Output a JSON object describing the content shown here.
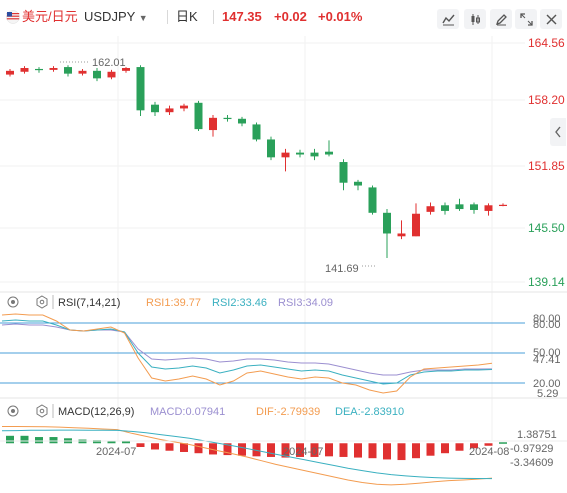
{
  "header": {
    "pair_name": "美元/日元",
    "symbol": "USDJPY",
    "interval": "日K",
    "price": "147.35",
    "change": "+0.02",
    "change_pct": "+0.01%"
  },
  "colors": {
    "up": "#e03030",
    "down": "#2aa05a",
    "rsi1": "#f39c50",
    "rsi2": "#3ab0c0",
    "rsi3": "#9b8fd0",
    "axis_label": "#e03030"
  },
  "main": {
    "price_labels": [
      "164.56",
      "158.20",
      "151.85",
      "145.50",
      "139.14"
    ],
    "high_marker": "162.01",
    "low_marker": "141.69"
  },
  "rsi": {
    "title": "RSI(7,14,21)",
    "rsi1": "RSI1:39.77",
    "rsi2": "RSI2:33.46",
    "rsi3": "RSI3:34.09",
    "axis_labels": [
      "80.00",
      "80.00",
      "50.00",
      "47.41",
      "20.00",
      "5.29"
    ]
  },
  "macd": {
    "title": "MACD(12,26,9)",
    "macd": "MACD:0.07941",
    "dif": "DIF:-2.79939",
    "dea": "DEA:-2.83910",
    "axis_labels": [
      "1.38751",
      "-0.97929",
      "-3.34609"
    ]
  },
  "x_axis": {
    "labels": [
      "2024-07",
      "2024-07",
      "2024-08"
    ]
  },
  "chart_data": [
    {
      "type": "candlestick",
      "series": "USDJPY daily",
      "y_ticks": [
        164.56,
        158.2,
        151.85,
        145.5,
        139.14
      ],
      "ylim": [
        139.14,
        164.56
      ],
      "annotations": [
        {
          "label": "162.01"
        },
        {
          "label": "141.69"
        }
      ],
      "candles": [
        {
          "o": 161.2,
          "c": 161.6,
          "h": 161.8,
          "l": 161.0
        },
        {
          "o": 161.5,
          "c": 161.9,
          "h": 162.1,
          "l": 161.3
        },
        {
          "o": 161.8,
          "c": 161.7,
          "h": 162.0,
          "l": 161.4
        },
        {
          "o": 161.7,
          "c": 161.9,
          "h": 162.1,
          "l": 161.5
        },
        {
          "o": 162.0,
          "c": 161.3,
          "h": 162.2,
          "l": 161.0
        },
        {
          "o": 161.3,
          "c": 161.6,
          "h": 161.8,
          "l": 161.1
        },
        {
          "o": 161.6,
          "c": 160.8,
          "h": 161.9,
          "l": 160.5
        },
        {
          "o": 160.9,
          "c": 161.5,
          "h": 161.7,
          "l": 160.7
        },
        {
          "o": 161.6,
          "c": 161.9,
          "h": 162.0,
          "l": 161.4
        },
        {
          "o": 162.0,
          "c": 157.4,
          "h": 162.2,
          "l": 156.8
        },
        {
          "o": 158.0,
          "c": 157.2,
          "h": 158.3,
          "l": 156.8
        },
        {
          "o": 157.2,
          "c": 157.6,
          "h": 157.9,
          "l": 156.9
        },
        {
          "o": 157.6,
          "c": 157.9,
          "h": 158.1,
          "l": 157.3
        },
        {
          "o": 158.2,
          "c": 155.4,
          "h": 158.4,
          "l": 155.2
        },
        {
          "o": 155.3,
          "c": 156.6,
          "h": 156.9,
          "l": 154.6
        },
        {
          "o": 156.6,
          "c": 156.5,
          "h": 156.9,
          "l": 156.2
        },
        {
          "o": 156.5,
          "c": 156.0,
          "h": 156.7,
          "l": 155.7
        },
        {
          "o": 155.9,
          "c": 154.3,
          "h": 156.1,
          "l": 154.1
        },
        {
          "o": 154.3,
          "c": 152.4,
          "h": 154.6,
          "l": 152.1
        },
        {
          "o": 152.4,
          "c": 152.9,
          "h": 153.3,
          "l": 150.9
        },
        {
          "o": 152.9,
          "c": 152.7,
          "h": 153.2,
          "l": 152.4
        },
        {
          "o": 152.9,
          "c": 152.5,
          "h": 153.3,
          "l": 152.1
        },
        {
          "o": 153.0,
          "c": 152.7,
          "h": 154.2,
          "l": 152.5
        },
        {
          "o": 151.9,
          "c": 149.7,
          "h": 152.2,
          "l": 148.9
        },
        {
          "o": 149.8,
          "c": 149.4,
          "h": 150.0,
          "l": 148.9
        },
        {
          "o": 149.2,
          "c": 146.5,
          "h": 149.4,
          "l": 146.3
        },
        {
          "o": 146.5,
          "c": 144.3,
          "h": 146.9,
          "l": 141.69
        },
        {
          "o": 144.0,
          "c": 144.3,
          "h": 145.7,
          "l": 143.7
        },
        {
          "o": 144.0,
          "c": 146.4,
          "h": 147.5,
          "l": 144.0
        },
        {
          "o": 146.6,
          "c": 147.2,
          "h": 147.6,
          "l": 146.3
        },
        {
          "o": 147.3,
          "c": 146.7,
          "h": 147.6,
          "l": 146.3
        },
        {
          "o": 147.4,
          "c": 146.9,
          "h": 148.0,
          "l": 146.7
        },
        {
          "o": 147.4,
          "c": 146.8,
          "h": 147.6,
          "l": 146.4
        },
        {
          "o": 146.7,
          "c": 147.3,
          "h": 147.5,
          "l": 146.2
        },
        {
          "o": 147.33,
          "c": 147.35,
          "h": 147.5,
          "l": 147.2
        }
      ]
    },
    {
      "type": "line",
      "series": "RSI",
      "ylim": [
        0,
        100
      ],
      "reference_lines": [
        80,
        50,
        20
      ],
      "rsi1": [
        88,
        89,
        88,
        88,
        82,
        73,
        72,
        74,
        76,
        70,
        45,
        25,
        22,
        24,
        27,
        24,
        18,
        22,
        30,
        32,
        29,
        26,
        24,
        26,
        25,
        20,
        18,
        13,
        10,
        12,
        26,
        34,
        35,
        36,
        37,
        38,
        39.77
      ],
      "rsi2": [
        82,
        83,
        82,
        82,
        78,
        73,
        72,
        73,
        74,
        71,
        50,
        36,
        34,
        35,
        37,
        35,
        30,
        33,
        37,
        38,
        36,
        34,
        32,
        33,
        32,
        28,
        25,
        22,
        19,
        20,
        28,
        31,
        32,
        32,
        33,
        33,
        33.46
      ],
      "rsi3": [
        78,
        79,
        78,
        78,
        76,
        73,
        72,
        73,
        73,
        71,
        54,
        44,
        43,
        44,
        45,
        44,
        41,
        42,
        44,
        44,
        43,
        41,
        40,
        40,
        39,
        36,
        33,
        30,
        28,
        28,
        31,
        33,
        33,
        33,
        34,
        34,
        34.09
      ]
    },
    {
      "type": "bar+line",
      "series": "MACD",
      "ylim": [
        -3.9,
        1.8
      ],
      "macd_hist": [
        0.6,
        0.6,
        0.5,
        0.5,
        0.4,
        0.3,
        0.25,
        0.2,
        0.15,
        -0.3,
        -0.5,
        -0.6,
        -0.7,
        -0.8,
        -0.9,
        -0.95,
        -1.0,
        -1.05,
        -1.1,
        -1.15,
        -1.1,
        -1.1,
        -1.05,
        -1.1,
        -1.15,
        -1.2,
        -1.3,
        -1.35,
        -1.2,
        -1.0,
        -0.8,
        -0.6,
        -0.4,
        -0.2,
        0.07941
      ],
      "dif": [
        1.35,
        1.35,
        1.34,
        1.33,
        1.3,
        1.25,
        1.2,
        1.15,
        1.1,
        0.8,
        0.55,
        0.3,
        0.1,
        -0.1,
        -0.35,
        -0.6,
        -0.85,
        -1.1,
        -1.4,
        -1.7,
        -1.95,
        -2.2,
        -2.45,
        -2.7,
        -2.95,
        -3.15,
        -3.3,
        -3.35,
        -3.3,
        -3.2,
        -3.1,
        -3.0,
        -2.95,
        -2.88,
        -2.79939
      ],
      "dea": [
        1.0,
        1.02,
        1.04,
        1.05,
        1.06,
        1.06,
        1.05,
        1.04,
        1.03,
        0.95,
        0.85,
        0.7,
        0.55,
        0.4,
        0.2,
        0.0,
        -0.2,
        -0.42,
        -0.65,
        -0.88,
        -1.1,
        -1.32,
        -1.55,
        -1.78,
        -2.0,
        -2.2,
        -2.38,
        -2.52,
        -2.62,
        -2.7,
        -2.76,
        -2.8,
        -2.82,
        -2.835,
        -2.8391
      ]
    }
  ]
}
